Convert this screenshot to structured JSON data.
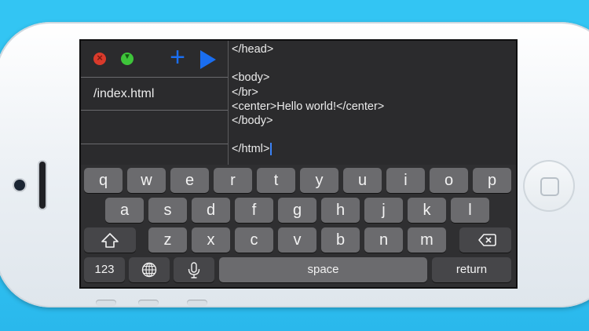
{
  "toolbar": {
    "close_glyph": "×",
    "minimize_glyph": "▼",
    "add_glyph": "+"
  },
  "sidebar": {
    "files": [
      "/index.html",
      ""
    ]
  },
  "editor": {
    "lines": [
      "</head>",
      "",
      "<body>",
      "</br>",
      "<center>Hello world!</center>",
      "</body>",
      "",
      "</html>"
    ]
  },
  "keyboard": {
    "row1": [
      "q",
      "w",
      "e",
      "r",
      "t",
      "y",
      "u",
      "i",
      "o",
      "p"
    ],
    "row2": [
      "a",
      "s",
      "d",
      "f",
      "g",
      "h",
      "j",
      "k",
      "l"
    ],
    "row3": [
      "z",
      "x",
      "c",
      "v",
      "b",
      "n",
      "m"
    ],
    "numbers_label": "123",
    "space_label": "space",
    "return_label": "return"
  },
  "colors": {
    "accent": "#1a6ef0",
    "close": "#d93a2b",
    "minimize": "#3ec53a",
    "background": "#33c5f3"
  },
  "icons": [
    "shift-icon",
    "globe-icon",
    "microphone-icon",
    "delete-icon",
    "play-icon",
    "plus-icon"
  ]
}
